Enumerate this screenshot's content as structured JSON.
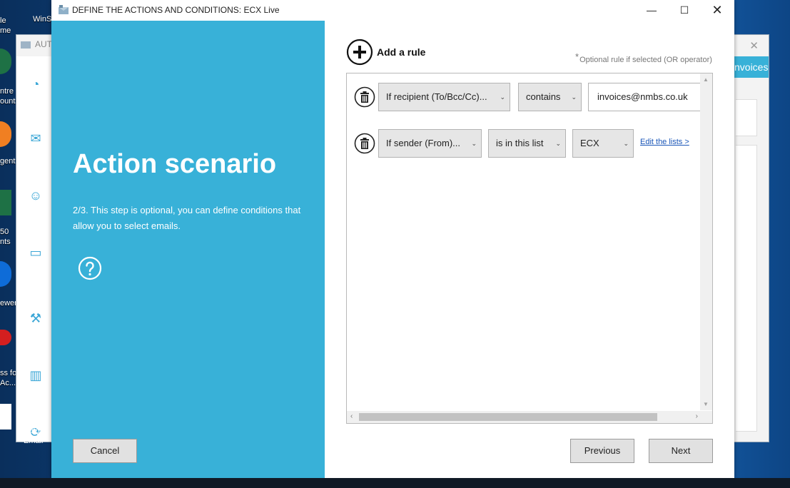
{
  "window": {
    "title": "DEFINE THE ACTIONS AND CONDITIONS: ECX Live",
    "minimize_glyph": "—",
    "maximize_glyph": "☐",
    "close_glyph": "✕"
  },
  "desktop": {
    "icons": [
      {
        "label": "le\nme"
      },
      {
        "label": "WinS"
      },
      {
        "label": "ntre\nounts"
      },
      {
        "label": "gent"
      },
      {
        "label": "50\nnts"
      },
      {
        "label": "ewer"
      },
      {
        "label": "ss fo\nAc..."
      }
    ]
  },
  "background_app": {
    "title": "AUT",
    "header_text": "nvoices",
    "sidebar_label": "Autom\nEmail",
    "close_glyph": "✕"
  },
  "left_panel": {
    "heading": "Action scenario",
    "description": "2/3. This step is optional, you can define conditions that allow you to select emails.",
    "cancel_label": "Cancel",
    "help_icon": "question-circle-icon"
  },
  "main": {
    "add_rule_label": "Add a rule",
    "optional_star": "*",
    "optional_note": "Optional rule if selected (OR operator)",
    "rules": [
      {
        "field": "If recipient (To/Bcc/Cc)...",
        "operator": "contains",
        "value": "invoices@nmbs.co.uk"
      },
      {
        "field": "If sender (From)...",
        "operator": "is in this list",
        "value": "ECX",
        "link": "Edit the lists >"
      }
    ],
    "previous_label": "Previous",
    "next_label": "Next"
  },
  "colors": {
    "accent": "#38b1d8",
    "link": "#1a56b8",
    "button_bg": "#e1e1e1"
  }
}
